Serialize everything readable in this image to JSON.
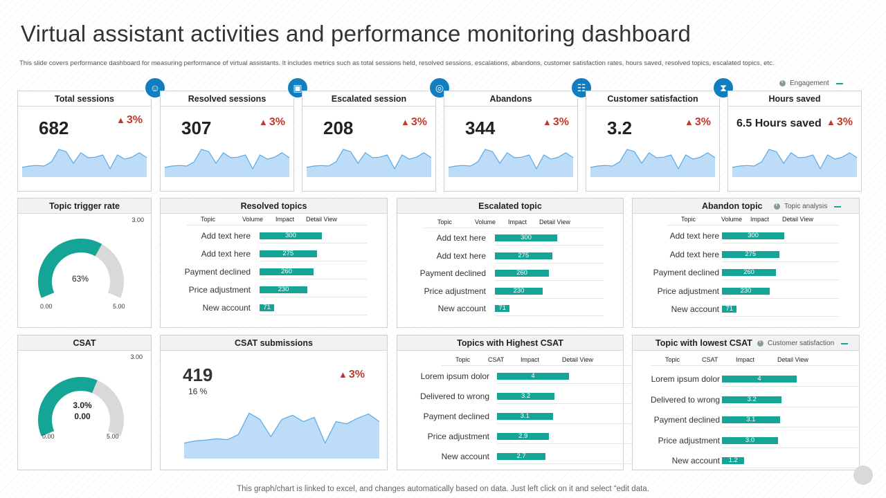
{
  "header": {
    "title": "Virtual assistant activities and performance monitoring dashboard",
    "subtitle": "This slide covers performance dashboard for measuring performance of virtual assistants. It includes metrics such as total sessions held, resolved sessions, escalations, abandons, customer satisfaction rates, hours saved, resolved topics, escalated topics, etc."
  },
  "legends": {
    "engagement": "Engagement",
    "topic_analysis": "Topic analysis",
    "customer_satisfaction": "Customer satisfaction"
  },
  "colors": {
    "accent": "#14a596",
    "icon_blue": "#117fbf",
    "delta_red": "#c0392b",
    "spark_fill": "#bcdcf7",
    "spark_line": "#5aa9e6",
    "gauge_gray": "#d9d9d9"
  },
  "kpis": [
    {
      "title": "Total sessions",
      "value": "682",
      "delta": "3%",
      "icon": "assistant-icon"
    },
    {
      "title": "Resolved sessions",
      "value": "307",
      "delta": "3%",
      "icon": "presentation-icon"
    },
    {
      "title": "Escalated session",
      "value": "208",
      "delta": "3%",
      "icon": "compass-icon"
    },
    {
      "title": "Abandons",
      "value": "344",
      "delta": "3%",
      "icon": "team-icon"
    },
    {
      "title": "Customer satisfaction",
      "value": "3.2",
      "delta": "3%",
      "icon": "hourglass-icon"
    },
    {
      "title": "Hours saved",
      "value": "6.5 Hours saved",
      "delta": "3%",
      "icon": ""
    }
  ],
  "spark_values": [
    0.25,
    0.3,
    0.32,
    0.3,
    0.45,
    0.9,
    0.82,
    0.4,
    0.78,
    0.6,
    0.62,
    0.7,
    0.2,
    0.7,
    0.55,
    0.62,
    0.78,
    0.6
  ],
  "gauges": [
    {
      "title": "Topic trigger rate",
      "center": "63%",
      "center2": "",
      "min": "0.00",
      "max": "5.00",
      "top": "3.00",
      "percent": 0.63
    },
    {
      "title": "CSAT",
      "center": "3.0%",
      "center2": "0.00",
      "min": "0.00",
      "max": "5.00",
      "top": "3.00",
      "percent": 0.6
    }
  ],
  "tables": {
    "resolved": {
      "title": "Resolved topics",
      "cols": [
        "Topic",
        "Volume",
        "Impact",
        "Detail View"
      ],
      "rows": [
        {
          "label": "Add text here",
          "value": "300",
          "n": 300
        },
        {
          "label": "Add text here",
          "value": "275",
          "n": 275
        },
        {
          "label": "Payment declined",
          "value": "260",
          "n": 260
        },
        {
          "label": "Price adjustment",
          "value": "230",
          "n": 230
        },
        {
          "label": "New account",
          "value": "71",
          "n": 71
        }
      ]
    },
    "escalated": {
      "title": "Escalated topic",
      "cols": [
        "Topic",
        "Volume",
        "Impact",
        "Detail View"
      ],
      "rows": [
        {
          "label": "Add text here",
          "value": "300",
          "n": 300
        },
        {
          "label": "Add text here",
          "value": "275",
          "n": 275
        },
        {
          "label": "Payment declined",
          "value": "260",
          "n": 260
        },
        {
          "label": "Price adjustment",
          "value": "230",
          "n": 230
        },
        {
          "label": "New account",
          "value": "71",
          "n": 71
        }
      ]
    },
    "abandon": {
      "title": "Abandon topic",
      "cols": [
        "Topic",
        "Volume",
        "Impact",
        "Detail View"
      ],
      "rows": [
        {
          "label": "Add text here",
          "value": "300",
          "n": 300
        },
        {
          "label": "Add text here",
          "value": "275",
          "n": 275
        },
        {
          "label": "Payment declined",
          "value": "260",
          "n": 260
        },
        {
          "label": "Price adjustment",
          "value": "230",
          "n": 230
        },
        {
          "label": "New account",
          "value": "71",
          "n": 71
        }
      ]
    },
    "highest": {
      "title": "Topics with Highest CSAT",
      "cols": [
        "Topic",
        "CSAT",
        "Impact",
        "Detail View"
      ],
      "rows": [
        {
          "label": "Lorem ipsum dolor",
          "value": "4",
          "n": 4
        },
        {
          "label": "Delivered to wrong",
          "value": "3.2",
          "n": 3.2
        },
        {
          "label": "Payment declined",
          "value": "3.1",
          "n": 3.1
        },
        {
          "label": "Price adjustment",
          "value": "2.9",
          "n": 2.9
        },
        {
          "label": "New account",
          "value": "2.7",
          "n": 2.7
        }
      ]
    },
    "lowest": {
      "title": "Topic with lowest CSAT",
      "cols": [
        "Topic",
        "CSAT",
        "Impact",
        "Detail View"
      ],
      "rows": [
        {
          "label": "Lorem ipsum dolor",
          "value": "4",
          "n": 4
        },
        {
          "label": "Delivered to wrong",
          "value": "3.2",
          "n": 3.2
        },
        {
          "label": "Payment declined",
          "value": "3.1",
          "n": 3.1
        },
        {
          "label": "Price adjustment",
          "value": "3.0",
          "n": 3.0
        },
        {
          "label": "New account",
          "value": "1.2",
          "n": 1.2
        }
      ]
    }
  },
  "csat_submissions": {
    "title": "CSAT submissions",
    "value": "419",
    "sub": "16 %",
    "delta": "3%",
    "values": [
      0.2,
      0.25,
      0.27,
      0.3,
      0.28,
      0.4,
      0.9,
      0.75,
      0.35,
      0.75,
      0.85,
      0.7,
      0.8,
      0.2,
      0.7,
      0.65,
      0.78,
      0.88,
      0.7
    ]
  },
  "footer": "This graph/chart is linked to excel,  and changes automatically based on data. Just left click on it and select “edit data."
}
